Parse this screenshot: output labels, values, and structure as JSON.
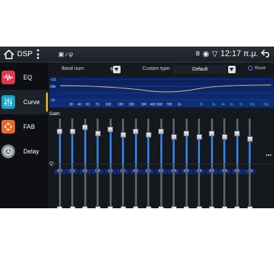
{
  "statusbar": {
    "title": "DSP",
    "left_icons": "▣♪ψ",
    "time": "12:17 π.μ.",
    "icons": [
      "home-icon",
      "more-vert-icon",
      "bluetooth-icon",
      "location-icon",
      "wifi-icon",
      "back-icon"
    ]
  },
  "sidebar": {
    "items": [
      {
        "label": "EQ",
        "icon": "waveform-icon",
        "color": "#e0364e"
      },
      {
        "label": "Curve",
        "icon": "sliders-icon",
        "color": "#1aa3c8"
      },
      {
        "label": "FAB",
        "icon": "fader-arrows-icon",
        "color": "#e8672a"
      },
      {
        "label": "Delay",
        "icon": "clock-icon",
        "color": "#8a8f96"
      }
    ],
    "active_index": 1
  },
  "controls": {
    "band_label": "Band num:",
    "band_value": "64",
    "custom_type_label": "Custom type:",
    "custom_type_value": "Default",
    "reset_label": "Reset"
  },
  "curve": {
    "y_ticks": [
      "+15",
      "0db",
      "-15"
    ],
    "x_ticks": [
      "30",
      "40",
      "50",
      "70",
      "100",
      "150",
      "200",
      "300",
      "400",
      "500",
      "700",
      "1k",
      "2k",
      "3k",
      "4k",
      "5k",
      "7k",
      "10k",
      "16k"
    ],
    "line_color": "#e8d27a",
    "background": "#0b2a70"
  },
  "gain": {
    "label": "Gain:",
    "values": [
      "0.9",
      "0.9",
      "1.8",
      "0.4",
      "1.4",
      "0.0",
      "0.9",
      "0.0",
      "0.9",
      "-0.5",
      "0.4",
      "-0.5",
      "0.4",
      "-0.5",
      "0.4",
      "-1.0"
    ],
    "more": "•••"
  },
  "q": {
    "label": "Q:",
    "values": [
      "2.20",
      "2.20",
      "2.20",
      "2.20",
      "2.20",
      "2.20",
      "2.20",
      "2.20",
      "2.20",
      "2.20",
      "2.20",
      "2.20",
      "2.20",
      "2.20",
      "2.20",
      "2.20"
    ]
  }
}
